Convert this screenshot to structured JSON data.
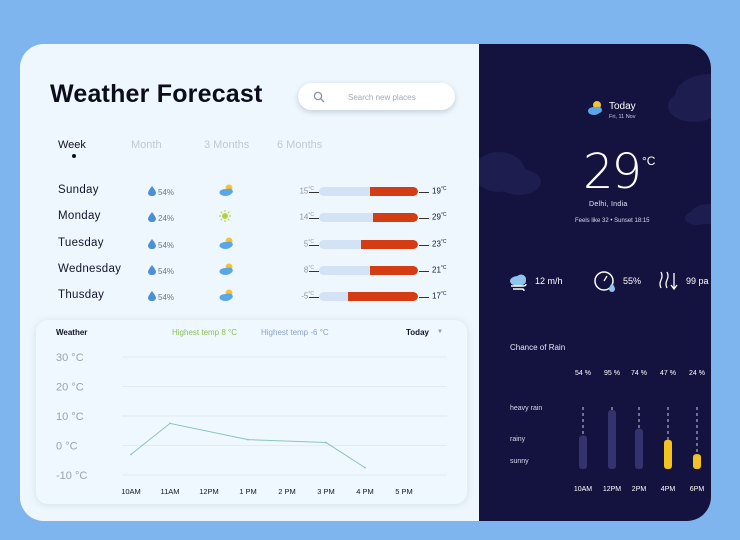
{
  "app": {
    "title": "Weather Forecast"
  },
  "search": {
    "placeholder": "Search new places"
  },
  "tabs": [
    {
      "label": "Week",
      "active": true
    },
    {
      "label": "Month",
      "active": false
    },
    {
      "label": "3 Months",
      "active": false
    },
    {
      "label": "6 Months",
      "active": false
    }
  ],
  "days": [
    {
      "name": "Sunday",
      "rain": "54%",
      "icon": "partly-cloudy-icon",
      "low": "15",
      "high": "19",
      "unit": "°C",
      "warm_fraction": 0.49
    },
    {
      "name": "Monday",
      "rain": "24%",
      "icon": "sun-icon",
      "low": "14",
      "high": "29",
      "unit": "°C",
      "warm_fraction": 0.45
    },
    {
      "name": "Tuesday",
      "rain": "54%",
      "icon": "partly-cloudy-icon",
      "low": "5",
      "high": "23",
      "unit": "°C",
      "warm_fraction": 0.58
    },
    {
      "name": "Wednesday",
      "rain": "54%",
      "icon": "partly-cloudy-icon",
      "low": "8",
      "high": "21",
      "unit": "°C",
      "warm_fraction": 0.49
    },
    {
      "name": "Thusday",
      "rain": "54%",
      "icon": "partly-cloudy-icon",
      "low": "-5",
      "high": "17",
      "unit": "°C",
      "warm_fraction": 0.71
    }
  ],
  "chart": {
    "title": "Weather",
    "legend_green": "Highest temp 8 °C",
    "legend_blue": "Highest temp -6 °C",
    "range_select": "Today",
    "line_color": "#8cc5b5"
  },
  "chart_data": {
    "type": "line",
    "x": [
      "10AM",
      "11AM",
      "12PM",
      "1 PM",
      "2 PM",
      "3 PM",
      "4 PM",
      "5 PM"
    ],
    "series": [
      {
        "values": [
          -3,
          7.5,
          2,
          null,
          1,
          -7.5,
          null,
          null
        ],
        "x_positions": [
          "10AM",
          "11AM",
          "1 PM",
          "2 PM",
          "3 PM",
          "4 PM"
        ]
      }
    ],
    "points": [
      {
        "x": "10AM",
        "y": -3
      },
      {
        "x": "11AM",
        "y": 7.5
      },
      {
        "x": "1 PM",
        "y": 2
      },
      {
        "x": "3 PM",
        "y": 1
      },
      {
        "x": "4 PM",
        "y": -7.5
      }
    ],
    "y_ticks": [
      "30 °C",
      "20 °C",
      "10 °C",
      "0 °C",
      "-10 °C"
    ],
    "ylim": [
      -10,
      30
    ]
  },
  "today": {
    "label": "Today",
    "date": "Fri, 11 Nov",
    "temp": "29",
    "degree": "°C",
    "city": "Delhi, India",
    "feels": "Feels like 32",
    "sunset": "Sunset 18:15"
  },
  "stats": [
    {
      "icon": "wind-icon",
      "value": "12 m/h"
    },
    {
      "icon": "humidity-gauge-icon",
      "value": "55%"
    },
    {
      "icon": "pressure-icon",
      "value": "99 pa"
    }
  ],
  "rain_chart": {
    "title": "Chance of Rain",
    "levels": [
      "heavy rain",
      "rainy",
      "sunny"
    ],
    "hours": [
      "10AM",
      "12PM",
      "2PM",
      "4PM",
      "6PM"
    ],
    "percents": [
      "54 %",
      "95 %",
      "74 %",
      "47 %",
      "24 %"
    ],
    "bar_levels": [
      0.54,
      0.95,
      0.65,
      0.47,
      0.24
    ],
    "highlight": [
      false,
      false,
      false,
      true,
      true
    ],
    "colors": {
      "dark": "#34336d",
      "yellow": "#f2c321"
    }
  }
}
